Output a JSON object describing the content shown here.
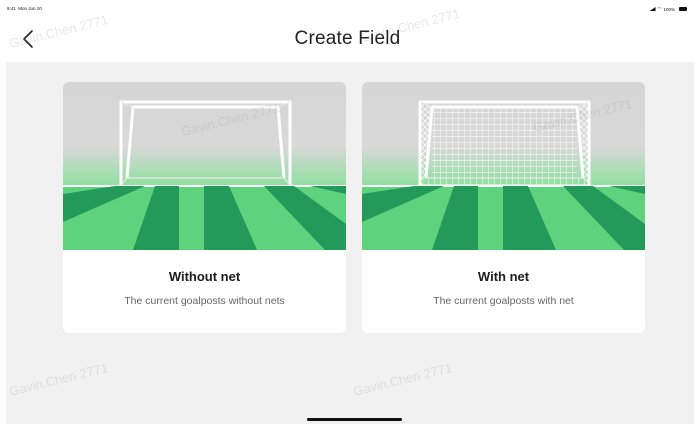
{
  "status_bar": {
    "time": "9:41",
    "date": "Mon Jun 10",
    "battery": "100%"
  },
  "header": {
    "title": "Create Field",
    "back_icon": "chevron-left-icon"
  },
  "cards": [
    {
      "title": "Without net",
      "description": "The current goalposts without nets",
      "illustration": "goal-without-net"
    },
    {
      "title": "With net",
      "description": "The current goalposts with net",
      "illustration": "goal-with-net"
    }
  ],
  "watermark": "Gavin.Chen 2771",
  "colors": {
    "background": "#f1f1f1",
    "card": "#ffffff",
    "pitch_light": "#5fd27d",
    "pitch_dark": "#239a5a",
    "sky_gray": "#d9d9d9"
  }
}
